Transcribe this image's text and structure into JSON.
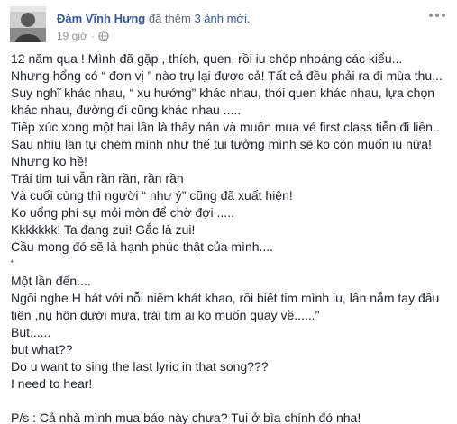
{
  "post": {
    "author": "Đàm Vĩnh Hưng",
    "action_prefix": " đã thêm ",
    "action_link": "3 ảnh mới.",
    "time": "19 giờ",
    "privacy_sep": "·",
    "privacy_icon": "globe-icon",
    "more_icon": "more-options-icon",
    "lines": [
      "12 năm qua ! Mình đã gặp , thích, quen, rồi iu chóp nhoáng các kiểu...",
      "Nhưng hổng có “ đơn vị ” nào trụ lại được cả! Tất cả đều phải ra đi mùa thu...",
      "Suy nghĩ khác nhau, “ xu hướng” khác nhau, thói quen khác nhau, lựa chọn",
      "khác nhau, đường đi cũng khác nhau .....",
      "Tiếp xúc xong một hai lần là thấy nản và muốn mua vé first class tiễn đi liền..",
      "Sau nhìu lần tự chém mình như thế tui tưởng mình sẽ ko còn muốn iu nữa!",
      "Nhưng ko hề!",
      "Trái tim tui vẫn rần rần, rần rần",
      "Và cuối cùng thì người “ như ý” cũng đã xuất hiện!",
      "Ko uổng phí sự mỏi mòn để chờ đợi .....",
      "Kkkkkkk! Ta đang zui! Gắc là zui!",
      "Cầu mong đó sẽ là hạnh phúc thật của mình....",
      "“",
      "Một lần đến....",
      "Ngồi nghe H hát với nỗi niềm khát khao, rồi biết tim mình iu, lần nắm tay đầu",
      "tiên ,nụ hôn dưới mưa, trái tim ai ko muốn quay về......”",
      "But......",
      "but what??",
      "Do u want to sing the last lyric in that song???",
      "I need to hear!",
      "",
      "P/s : Cả nhà mình mua báo này chưa? Tui ở bìa chính đó nha!"
    ]
  }
}
